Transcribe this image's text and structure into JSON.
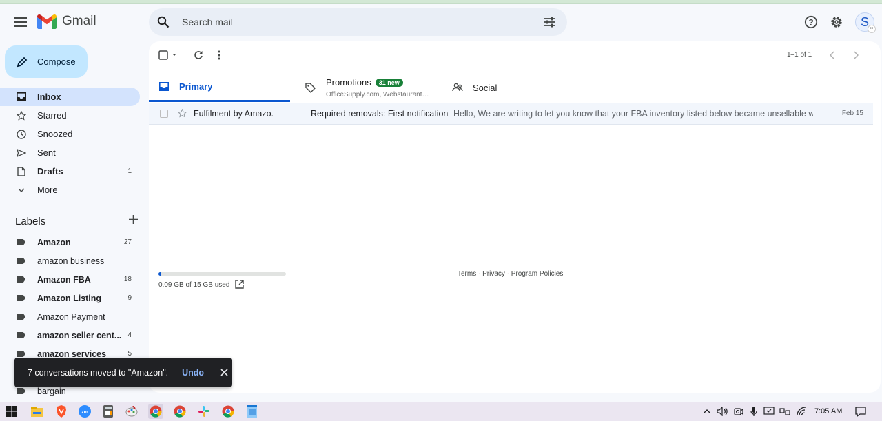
{
  "app": {
    "name": "Gmail"
  },
  "search": {
    "placeholder": "Search mail"
  },
  "account": {
    "initial": "S"
  },
  "sidebar": {
    "compose_label": "Compose",
    "items": [
      {
        "label": "Inbox",
        "count": "",
        "icon": "inbox-icon"
      },
      {
        "label": "Starred",
        "count": "",
        "icon": "star-icon"
      },
      {
        "label": "Snoozed",
        "count": "",
        "icon": "clock-icon"
      },
      {
        "label": "Sent",
        "count": "",
        "icon": "send-icon"
      },
      {
        "label": "Drafts",
        "count": "1",
        "icon": "draft-icon"
      },
      {
        "label": "More",
        "count": "",
        "icon": "chevron-down-icon"
      }
    ],
    "labels_title": "Labels",
    "labels": [
      {
        "label": "Amazon",
        "count": "27"
      },
      {
        "label": "amazon business",
        "count": ""
      },
      {
        "label": "Amazon FBA",
        "count": "18"
      },
      {
        "label": "Amazon Listing",
        "count": "9"
      },
      {
        "label": "Amazon Payment",
        "count": ""
      },
      {
        "label": "amazon seller cent...",
        "count": "4"
      },
      {
        "label": "amazon services",
        "count": "5"
      },
      {
        "label": "",
        "count": ""
      },
      {
        "label": "bargain",
        "count": ""
      }
    ]
  },
  "toolbar": {
    "pager": "1–1 of 1"
  },
  "tabs": {
    "primary": "Primary",
    "promotions": "Promotions",
    "promotions_badge": "31 new",
    "promotions_sub": "OfficeSupply.com, Webstaurant…",
    "social": "Social"
  },
  "emails": [
    {
      "sender": "Fulfilment by Amazo.",
      "subject": "Required removals: First notification",
      "snippet": " - Hello, We are writing to let you know that your FBA inventory listed below became unsellable wit...",
      "date": "Feb 15"
    }
  ],
  "storage": {
    "text": "0.09 GB of 15 GB used",
    "fraction": 0.006
  },
  "footer": {
    "links": "Terms · Privacy · Program Policies"
  },
  "snackbar": {
    "message": "7 conversations moved to \"Amazon\".",
    "action": "Undo"
  },
  "taskbar": {
    "time": "7:05 AM"
  },
  "colors": {
    "accent": "#0b57d0",
    "compose_bg": "#c2e7ff",
    "active_nav": "#d3e3fd",
    "badge_green": "#188038"
  }
}
